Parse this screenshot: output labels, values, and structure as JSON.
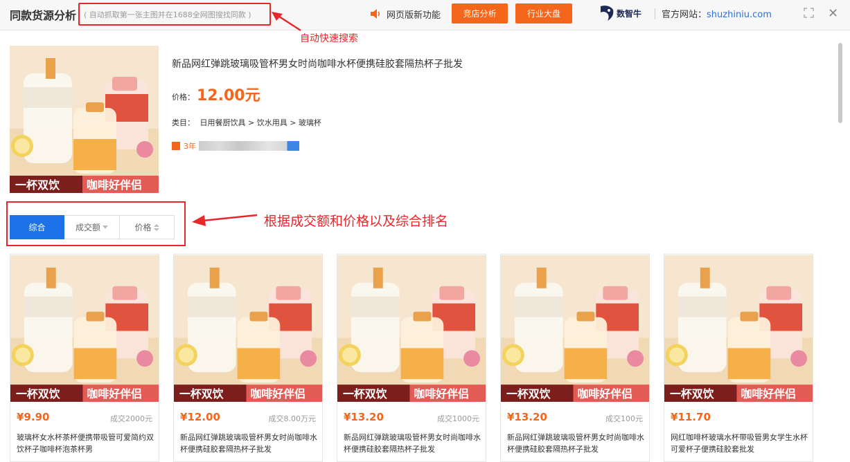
{
  "header": {
    "title": "同款货源分析",
    "subtitle": "( 自动抓取第一张主图并在1688全网图搜找同款 )",
    "new_feature": "网页版新功能",
    "btn_shop": "竞店分析",
    "btn_industry": "行业大盘",
    "logo_text": "数智牛",
    "site_label": "官方网站：",
    "site_url": "shuzhiniu.com"
  },
  "annotations": {
    "auto_search": "自动快速搜索",
    "sort_note": "根据成交额和价格以及综合排名"
  },
  "product": {
    "title": "新品网红弹跳玻璃吸管杯男女时尚咖啡水杯便携硅胶套隔热杯子批发",
    "price_label": "价格：",
    "price": "12.00元",
    "category_label": "类目：",
    "category": "日用餐厨饮具 > 饮水用具 > 玻璃杯",
    "years": "3年",
    "banner_left": "一杯双饮",
    "banner_right": "咖啡好伴侣"
  },
  "sort": {
    "tabs": [
      "综合",
      "成交额",
      "价格"
    ],
    "active": 0
  },
  "results": [
    {
      "price": "¥9.90",
      "sales": "成交2000元",
      "name": "玻璃杯女水杯茶杯便携带吸管可爱简约双饮杯子咖啡杯泡茶杯男"
    },
    {
      "price": "¥12.00",
      "sales": "成交8.00万元",
      "name": "新品网红弹跳玻璃吸管杯男女时尚咖啡水杯便携硅胶套隔热杯子批发"
    },
    {
      "price": "¥13.20",
      "sales": "成交1000元",
      "name": "新品网红弹跳玻璃吸管杯男女时尚咖啡水杯便携硅胶套隔热杯子批发"
    },
    {
      "price": "¥13.20",
      "sales": "成交100元",
      "name": "新品网红弹跳玻璃吸管杯男女时尚咖啡水杯便携硅胶套隔热杯子批发"
    },
    {
      "price": "¥11.70",
      "sales": "",
      "name": "网红咖啡杯玻璃水杯带吸管男女学生水杯可爱杯子便携硅胶套批发"
    }
  ],
  "colors": {
    "accent": "#f4661b",
    "primary": "#1e72e8",
    "annotation": "#e8262b"
  }
}
